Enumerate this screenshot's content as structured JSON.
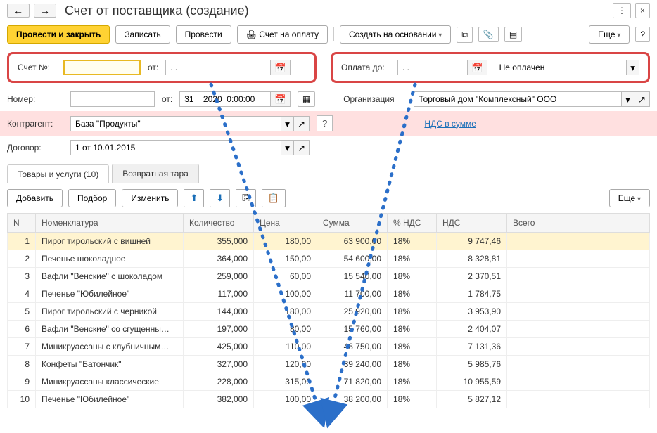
{
  "header": {
    "title": "Счет от поставщика (создание)"
  },
  "toolbar": {
    "post_close": "Провести и закрыть",
    "save": "Записать",
    "post": "Провести",
    "print": "Счет на оплату",
    "create_based": "Создать на основании",
    "more": "Еще"
  },
  "fields": {
    "schet_no_lbl": "Счет №:",
    "schet_no_val": "",
    "ot_lbl": "от:",
    "ot_val": ". .",
    "oplata_do_lbl": "Оплата до:",
    "oplata_do_val": ". .",
    "status_val": "Не оплачен",
    "nomer_lbl": "Номер:",
    "nomer_val": "",
    "nomer_date": "31    2020  0:00:00",
    "org_lbl": "Организация",
    "org_val": "Торговый дом \"Комплексный\" ООО",
    "kontragent_lbl": "Контрагент:",
    "kontragent_val": "База \"Продукты\"",
    "nds_link": "НДС в сумме",
    "dogovor_lbl": "Договор:",
    "dogovor_val": "1 от 10.01.2015"
  },
  "tabs": {
    "goods": "Товары и услуги (10)",
    "tara": "Возвратная тара"
  },
  "tablebar": {
    "add": "Добавить",
    "pick": "Подбор",
    "edit": "Изменить",
    "more": "Еще"
  },
  "columns": {
    "n": "N",
    "nom": "Номенклатура",
    "qty": "Количество",
    "price": "Цена",
    "sum": "Сумма",
    "vatpct": "% НДС",
    "vat": "НДС",
    "total": "Всего"
  },
  "rows": [
    {
      "n": "1",
      "nom": "Пирог тирольский с вишней",
      "qty": "355,000",
      "price": "180,00",
      "sum": "63 900,00",
      "vatpct": "18%",
      "vat": "9 747,46"
    },
    {
      "n": "2",
      "nom": "Печенье шоколадное",
      "qty": "364,000",
      "price": "150,00",
      "sum": "54 600,00",
      "vatpct": "18%",
      "vat": "8 328,81"
    },
    {
      "n": "3",
      "nom": "Вафли \"Венские\" с шоколадом",
      "qty": "259,000",
      "price": "60,00",
      "sum": "15 540,00",
      "vatpct": "18%",
      "vat": "2 370,51"
    },
    {
      "n": "4",
      "nom": "Печенье \"Юбилейное\"",
      "qty": "117,000",
      "price": "100,00",
      "sum": "11 700,00",
      "vatpct": "18%",
      "vat": "1 784,75"
    },
    {
      "n": "5",
      "nom": "Пирог тирольский с черникой",
      "qty": "144,000",
      "price": "180,00",
      "sum": "25 920,00",
      "vatpct": "18%",
      "vat": "3 953,90"
    },
    {
      "n": "6",
      "nom": "Вафли \"Венские\" со сгущенны…",
      "qty": "197,000",
      "price": "80,00",
      "sum": "15 760,00",
      "vatpct": "18%",
      "vat": "2 404,07"
    },
    {
      "n": "7",
      "nom": "Миникруассаны с клубничным…",
      "qty": "425,000",
      "price": "110,00",
      "sum": "46 750,00",
      "vatpct": "18%",
      "vat": "7 131,36"
    },
    {
      "n": "8",
      "nom": "Конфеты \"Батончик\"",
      "qty": "327,000",
      "price": "120,00",
      "sum": "39 240,00",
      "vatpct": "18%",
      "vat": "5 985,76"
    },
    {
      "n": "9",
      "nom": "Миникруассаны классические",
      "qty": "228,000",
      "price": "315,00",
      "sum": "71 820,00",
      "vatpct": "18%",
      "vat": "10 955,59"
    },
    {
      "n": "10",
      "nom": "Печенье \"Юбилейное\"",
      "qty": "382,000",
      "price": "100,00",
      "sum": "38 200,00",
      "vatpct": "18%",
      "vat": "5 827,12"
    }
  ]
}
